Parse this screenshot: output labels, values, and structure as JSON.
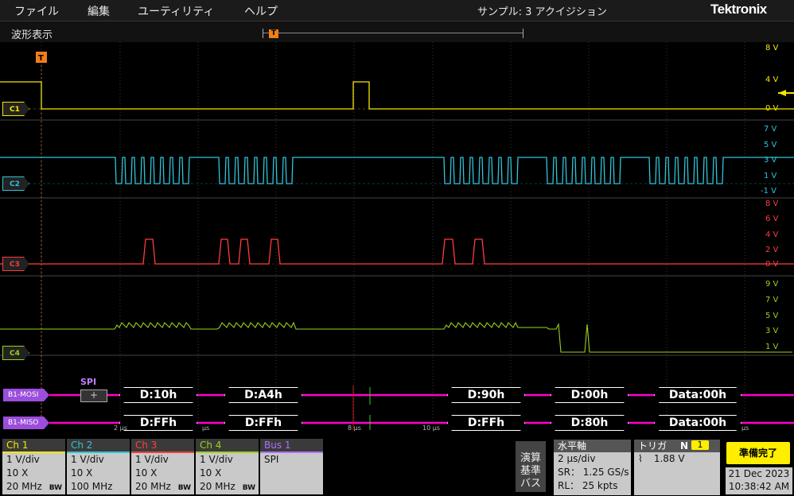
{
  "menu": {
    "file": "ファイル",
    "edit": "編集",
    "utility": "ユーティリティ",
    "help": "ヘルプ",
    "sample_info": "サンプル: 3 アクイジション",
    "logo": "Tektronix"
  },
  "waveform_view": {
    "title": "波形表示",
    "trigger_marker": "T"
  },
  "channels": {
    "c1": {
      "label": "C1",
      "color": "#f5e600",
      "scale": [
        "8 V",
        "4 V",
        "0 V"
      ]
    },
    "c2": {
      "label": "C2",
      "color": "#2fc4da",
      "scale": [
        "7 V",
        "5 V",
        "3 V",
        "1 V",
        "-1 V"
      ]
    },
    "c3": {
      "label": "C3",
      "color": "#ff3d3d",
      "scale": [
        "8 V",
        "6 V",
        "4 V",
        "2 V",
        "0 V"
      ]
    },
    "c4": {
      "label": "C4",
      "color": "#9ad21a",
      "scale": [
        "9 V",
        "7 V",
        "5 V",
        "3 V",
        "1 V"
      ]
    }
  },
  "bus": {
    "color": "#ff00cc",
    "label_color": "#9b4ddb",
    "indicator": "SPI",
    "indicator_button": "+",
    "mosi": {
      "label": "B1-MOSI",
      "packets": [
        "D:10h",
        "D:A4h",
        "D:90h",
        "D:00h",
        "Data:00h"
      ]
    },
    "miso": {
      "label": "B1-MISO",
      "packets": [
        "D:FFh",
        "D:FFh",
        "D:FFh",
        "D:80h",
        "Data:00h"
      ]
    }
  },
  "time_axis": {
    "ticks": [
      "2 µs",
      "µs",
      "8 µs",
      "10 µs",
      "µs"
    ]
  },
  "badges": [
    {
      "title": "Ch 1",
      "color": "#f5e600",
      "lines": [
        "1 V/div",
        "10 X",
        "20 MHz"
      ],
      "bw": "BW"
    },
    {
      "title": "Ch 2",
      "color": "#2fc4da",
      "lines": [
        "1 V/div",
        "10 X",
        "100 MHz"
      ],
      "bw": ""
    },
    {
      "title": "Ch 3",
      "color": "#ff3d3d",
      "lines": [
        "1 V/div",
        "10 X",
        "20 MHz"
      ],
      "bw": "BW"
    },
    {
      "title": "Ch 4",
      "color": "#9ad21a",
      "lines": [
        "1 V/div",
        "10 X",
        "20 MHz"
      ],
      "bw": "BW"
    },
    {
      "title": "Bus 1",
      "color": "#b070ff",
      "lines": [
        "SPI"
      ],
      "bw": ""
    }
  ],
  "math_ref_bus_button": [
    "演算",
    "基準",
    "バス"
  ],
  "horizontal": {
    "title": "水平軸",
    "scale": "2 µs/div",
    "sample_rate": "SR：  1.25 GS/s",
    "record_length": "RL：  25 kpts"
  },
  "trigger": {
    "title": "トリガ",
    "mode": "N",
    "source": "1",
    "level": "1.88 V"
  },
  "status": {
    "ready": "準備完了",
    "date": "21 Dec 2023",
    "time": "10:38:42 AM"
  }
}
